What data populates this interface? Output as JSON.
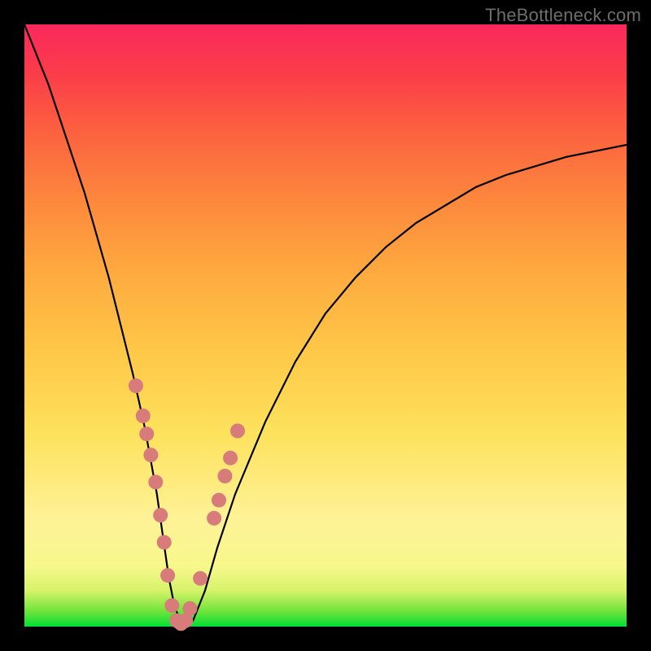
{
  "attribution": "TheBottleneck.com",
  "colors": {
    "marker": "#d87b7b",
    "curve": "#000000"
  },
  "chart_data": {
    "type": "line",
    "title": "",
    "xlabel": "",
    "ylabel": "",
    "xlim": [
      0,
      100
    ],
    "ylim": [
      0,
      100
    ],
    "series": [
      {
        "name": "bottleneck-curve",
        "x": [
          0,
          2,
          4,
          6,
          8,
          10,
          12,
          14,
          16,
          18,
          20,
          22,
          23,
          24,
          25,
          26,
          27,
          28,
          30,
          32,
          35,
          40,
          45,
          50,
          55,
          60,
          65,
          70,
          75,
          80,
          85,
          90,
          95,
          100
        ],
        "y": [
          100,
          95,
          90,
          84,
          78,
          72,
          65,
          58,
          50,
          42,
          33,
          22,
          15,
          8,
          3,
          1,
          0,
          1,
          6,
          13,
          22,
          34,
          44,
          52,
          58,
          63,
          67,
          70,
          73,
          75,
          76.5,
          78,
          79,
          80
        ]
      }
    ],
    "markers": {
      "name": "highlighted-points",
      "x": [
        18.5,
        19.7,
        20.3,
        21.0,
        21.8,
        22.6,
        23.2,
        23.8,
        24.5,
        25.3,
        26.0,
        26.8,
        27.5,
        29.2,
        31.5,
        32.3,
        33.3,
        34.2,
        35.4
      ],
      "y": [
        40.0,
        35.0,
        32.0,
        28.5,
        24.0,
        18.5,
        14.0,
        8.5,
        3.5,
        1.0,
        0.5,
        1.0,
        3.0,
        8.0,
        18.0,
        21.0,
        25.0,
        28.0,
        32.5
      ]
    }
  }
}
